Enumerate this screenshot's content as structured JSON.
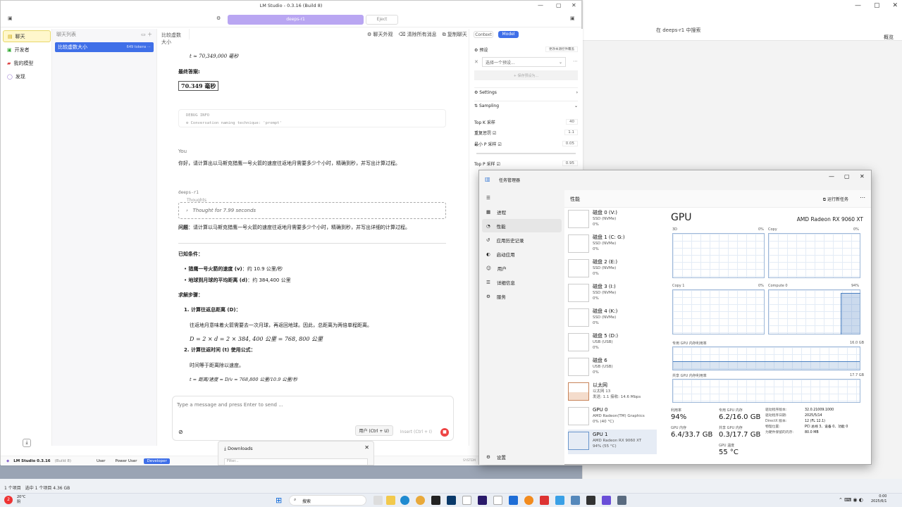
{
  "bg_window": {
    "search": "在 deeps-r1 中搜索",
    "overview": "概览"
  },
  "below": {
    "status": "1 个项目　选中 1 个项目  4.36 GB"
  },
  "lm": {
    "title": "LM Studio - 0.3.16 (Build 8)",
    "model_pill": "deeps-r1",
    "eject": "Eject",
    "nav": [
      "聊天",
      "开发者",
      "我的模型",
      "发现"
    ],
    "chat_list_header": "聊天列表",
    "chat_item": {
      "name": "比较虚数大小",
      "tokens": "649 tokens"
    },
    "tab": "比较虚数大小",
    "actions": [
      "聊天外观",
      "清除所有消息",
      "复制聊天"
    ],
    "msg": {
      "time_eq": "t ≈ 70,349,000 毫秒",
      "final_label": "最终答案:",
      "final_value": "70.349 毫秒",
      "debug_label": "DEBUG INFO",
      "debug_text": "Conversation naming technique: 'prompt'",
      "you": "You",
      "question": "你好，请计算出以马斯克猎鹰一号火箭的速度往返地月需要多少个小时，精确到秒，并写出计算过程。",
      "model": "deeps-r1",
      "thoughts_label": "Thoughts",
      "thought_for": "Thought for 7.99 seconds",
      "problem_label": "问题",
      "problem_text": "：请计算以马斯克猎鹰一号火箭的速度往返地月需要多少个小时，精确到秒，并写出详细的计算过程。",
      "known": "已知条件：",
      "b1_label": "猎鹰一号火箭的速度 (v)",
      "b1_val": "：约 10.9 公里/秒",
      "b2_label": "地球到月球的平均距离 (d)",
      "b2_val": "：约 384,400 公里",
      "steps": "求解步骤：",
      "s1": "计算往返总距离 (D)：",
      "s1_text": "往返地月意味着火箭需要去一次月球，再返回地球。因此，总距离为两倍单程距离。",
      "s1_eq": "D = 2 × d = 2 × 384, 400 公里 = 768, 800 公里",
      "s2": "计算往返时间 (t) 使用公式：",
      "s2_text": "时间等于距离除以速度。",
      "s2_eq": "t = 距离/速度 = D/v = 768,800 公里/10.9 公里/秒"
    },
    "composer": {
      "placeholder": "Type a message and press Enter to send ...",
      "user_btn": "用户 (Ctrl + U)",
      "insert_btn": "Insert (Ctrl + I)"
    },
    "right": {
      "tab_context": "Context",
      "tab_model": "Model",
      "preset_label": "预设",
      "preset_btn": "更改本源控件覆盖",
      "preset_select": "选择一个预设...",
      "save_preset": "+ 保存预设为...",
      "settings": "Settings",
      "sampling": "Sampling",
      "params": [
        {
          "label": "Top K 采样",
          "value": "40"
        },
        {
          "label": "重复惩罚 ☑",
          "value": "1.1"
        },
        {
          "label": "最小 P 采样 ☑",
          "value": "0.05"
        },
        {
          "label": "Top P 采样 ☑",
          "value": "0.95"
        }
      ]
    },
    "footer": {
      "brand": "LM Studio 0.3.16",
      "build": "(Build 8)",
      "modes": [
        "User",
        "Power User",
        "Developer"
      ],
      "system": "SYSTEM"
    },
    "downloads": {
      "title": "Downloads",
      "filter": "Filter..."
    }
  },
  "tm": {
    "title": "任务管理器",
    "nav": [
      "进程",
      "性能",
      "应用历史记录",
      "启动应用",
      "用户",
      "详细信息",
      "服务"
    ],
    "settings": "设置",
    "header": "性能",
    "run_task": "运行新任务",
    "devices": [
      {
        "name": "磁盘 0 (V:)",
        "sub": "SSD (NVMe)",
        "val": "0%"
      },
      {
        "name": "磁盘 1 (C: G:)",
        "sub": "SSD (NVMe)",
        "val": "0%"
      },
      {
        "name": "磁盘 2 (E:)",
        "sub": "SSD (NVMe)",
        "val": "0%"
      },
      {
        "name": "磁盘 3 (I:)",
        "sub": "SSD (NVMe)",
        "val": "0%"
      },
      {
        "name": "磁盘 4 (K:)",
        "sub": "SSD (NVMe)",
        "val": "0%"
      },
      {
        "name": "磁盘 5 (D:)",
        "sub": "USB (USB)",
        "val": "0%"
      },
      {
        "name": "磁盘 6",
        "sub": "USB (USB)",
        "val": "0%"
      },
      {
        "name": "以太网",
        "sub": "以太网 13",
        "val": "发送: 1.1 接收: 14.6 Mbps"
      },
      {
        "name": "GPU 0",
        "sub": "AMD Radeon(TM) Graphics",
        "val": "0% (40 °C)"
      },
      {
        "name": "GPU 1",
        "sub": "AMD Radeon RX 9060 XT",
        "val": "94% (55 °C)"
      }
    ],
    "gpu": {
      "title": "GPU",
      "model": "AMD Radeon RX 9060 XT",
      "g3d": "3D",
      "g3d_v": "0%",
      "gcopy": "Copy",
      "gcopy_v": "0%",
      "gcopy1": "Copy 1",
      "gcopy1_v": "0%",
      "gcompute": "Compute 0",
      "gcompute_v": "94%",
      "ded_label": "专用 GPU 内存利用率",
      "ded_max": "16.0 GB",
      "sh_label": "共享 GPU 内存利用率",
      "sh_max": "17.7 GB",
      "util_l": "利用率",
      "util_v": "94%",
      "ded_mem_l": "专用 GPU 内存",
      "ded_mem_v": "6.2/16.0 GB",
      "gpu_mem_l": "GPU 内存",
      "gpu_mem_v": "6.4/33.7 GB",
      "sh_mem_l": "共享 GPU 内存",
      "sh_mem_v": "0.3/17.7 GB",
      "temp_l": "GPU 温度",
      "temp_v": "55 °C",
      "info": [
        {
          "k": "驱动程序版本:",
          "v": "32.0.21009.1000"
        },
        {
          "k": "驱动程序日期:",
          "v": "2025/5/14"
        },
        {
          "k": "DirectX 版本:",
          "v": "12 (FL 12.1)"
        },
        {
          "k": "物理位置:",
          "v": "PCI 总线 3、设备 0、功能 0"
        },
        {
          "k": "为硬件保留的内存:",
          "v": "80.0 MB"
        }
      ]
    }
  },
  "taskbar": {
    "temp": "20°C",
    "weather": "阴",
    "search": "搜索",
    "time": "0:00",
    "date": "2025/6/1",
    "badge": "2"
  }
}
